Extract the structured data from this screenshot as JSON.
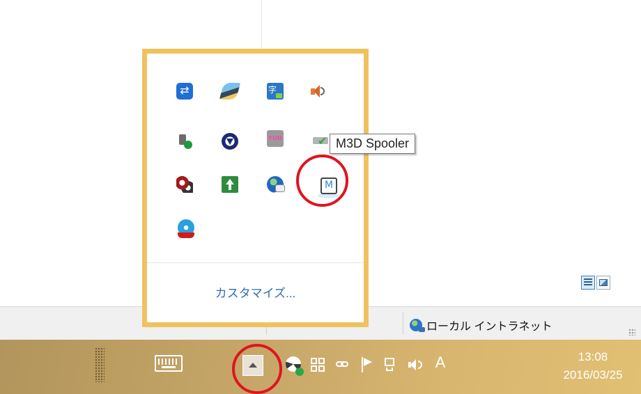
{
  "tray_overflow": {
    "customize_label": "カスタマイズ...",
    "icons": [
      "teamviewer-icon",
      "scanner-icon",
      "ime-dictionary-icon",
      "speaker-icon",
      "usb-safe-remove-icon",
      "navigation-icon",
      "fun-icon",
      "drive-ok-icon",
      "gear-app-icon",
      "update-arrow-icon",
      "globe-chat-icon",
      "m3d-spooler-icon",
      "disc-burner-icon"
    ],
    "border_color": "#f0c25e"
  },
  "tooltip": {
    "text": "M3D Spooler"
  },
  "status_bar": {
    "zone_label": "ローカル イントラネット"
  },
  "taskbar": {
    "clock_time": "13:08",
    "clock_date": "2016/03/25",
    "ime_mode": "A",
    "tray_icons": [
      "swirl-check-icon",
      "windows-icon",
      "link-icon",
      "flag-icon",
      "network-icon",
      "volume-icon"
    ]
  },
  "highlight_color": "#e0141f"
}
